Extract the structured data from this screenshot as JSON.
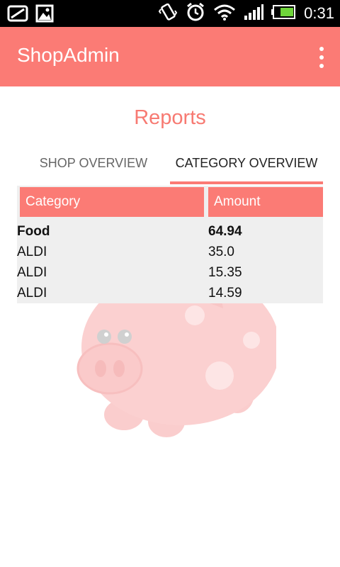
{
  "status": {
    "time": "0:31",
    "icons": [
      "screen-icon",
      "image-icon",
      "vibrate-icon",
      "alarm-icon",
      "wifi-icon",
      "signal-icon",
      "battery-icon"
    ]
  },
  "appbar": {
    "title": "ShopAdmin",
    "background": "#fb7b75"
  },
  "page": {
    "title": "Reports"
  },
  "tabs": [
    {
      "label": "SHOP OVERVIEW",
      "selected": false
    },
    {
      "label": "CATEGORY OVERVIEW",
      "selected": true
    }
  ],
  "table": {
    "headers": [
      "Category",
      "Amount"
    ],
    "rows": [
      {
        "category": "Food",
        "amount": "64.94"
      },
      {
        "category": "ALDI",
        "amount": "35.0"
      },
      {
        "category": "ALDI",
        "amount": "15.35"
      },
      {
        "category": "ALDI",
        "amount": "14.59"
      }
    ]
  }
}
